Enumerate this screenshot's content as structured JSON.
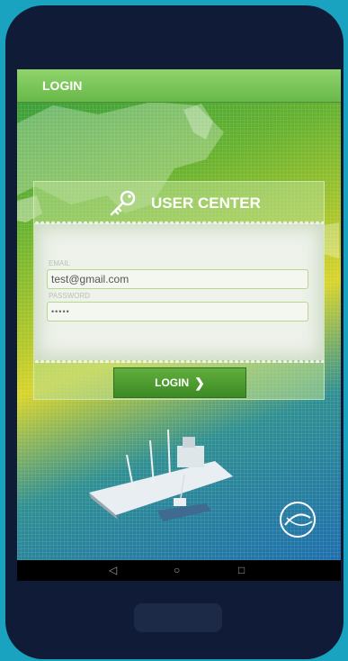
{
  "topbar": {
    "title": "LOGIN"
  },
  "panel": {
    "heading": "USER CENTER",
    "email_label": "EMAIL",
    "email_value": "test@gmail.com",
    "password_label": "PASSWORD",
    "password_value": "•••••",
    "login_label": "LOGIN",
    "login_chevron": "❯"
  },
  "navbar": {
    "back": "◁",
    "home": "○",
    "recents": "□"
  },
  "colors": {
    "accent_green": "#4b9a2e",
    "bezel": "#0f1b37",
    "frame": "#1aa3c0"
  },
  "icons": [
    "key-icon",
    "back-icon",
    "home-icon",
    "recents-icon"
  ]
}
